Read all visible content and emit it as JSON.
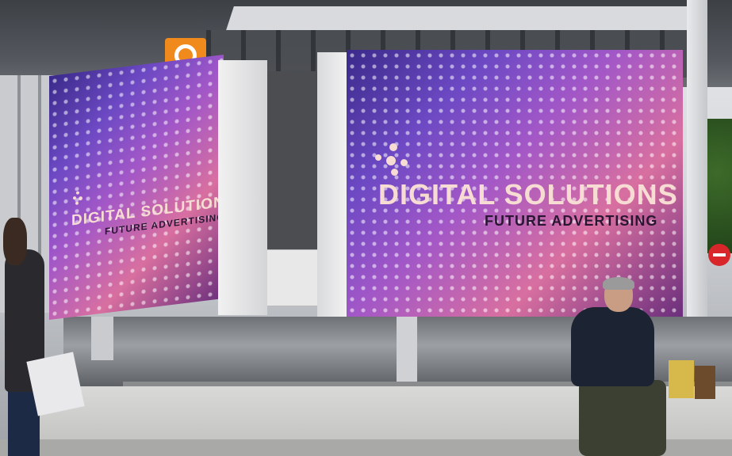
{
  "scene": {
    "description_colors": {
      "screen_gradient_start": "#3a2a8a",
      "screen_gradient_mid": "#a257c7",
      "screen_gradient_end": "#d86fa0",
      "brand_text": "#f6dcd2",
      "tagline_text": "#2a1633"
    }
  },
  "screens": {
    "left": {
      "brand": "DIGITAL SOLUTIONS",
      "tagline": "FUTURE ADVERTISING"
    },
    "right": {
      "brand": "DIGITAL SOLUTIONS",
      "tagline": "FUTURE ADVERTISING"
    }
  },
  "icons": {
    "logo": "dots-logo-icon",
    "sign": "no-entry-sign-icon",
    "orange_sign": "orange-ring-sign-icon"
  }
}
